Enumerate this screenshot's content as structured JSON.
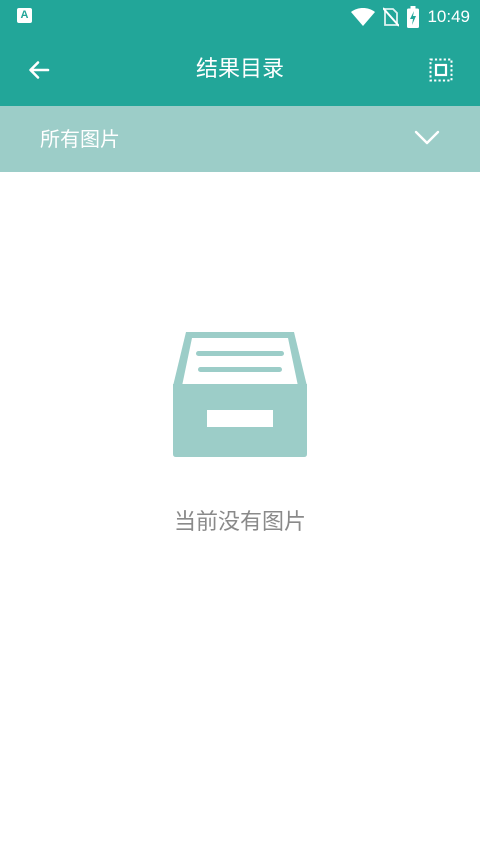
{
  "status_bar": {
    "app_icon_label": "A",
    "time": "10:49",
    "icons": [
      "wifi-icon",
      "no-sim-icon",
      "battery-charging-icon"
    ]
  },
  "toolbar": {
    "title": "结果目录",
    "back_icon": "arrow-left-icon",
    "select_icon": "select-all-icon"
  },
  "filter": {
    "selected": "所有图片",
    "chevron_icon": "chevron-down-icon"
  },
  "empty_state": {
    "illustration_icon": "empty-box-icon",
    "message": "当前没有图片"
  },
  "colors": {
    "primary": "#22a699",
    "filter_bar": "#9ccdc8",
    "illustration": "#9ccdc8",
    "empty_text": "#8a8a8a"
  }
}
